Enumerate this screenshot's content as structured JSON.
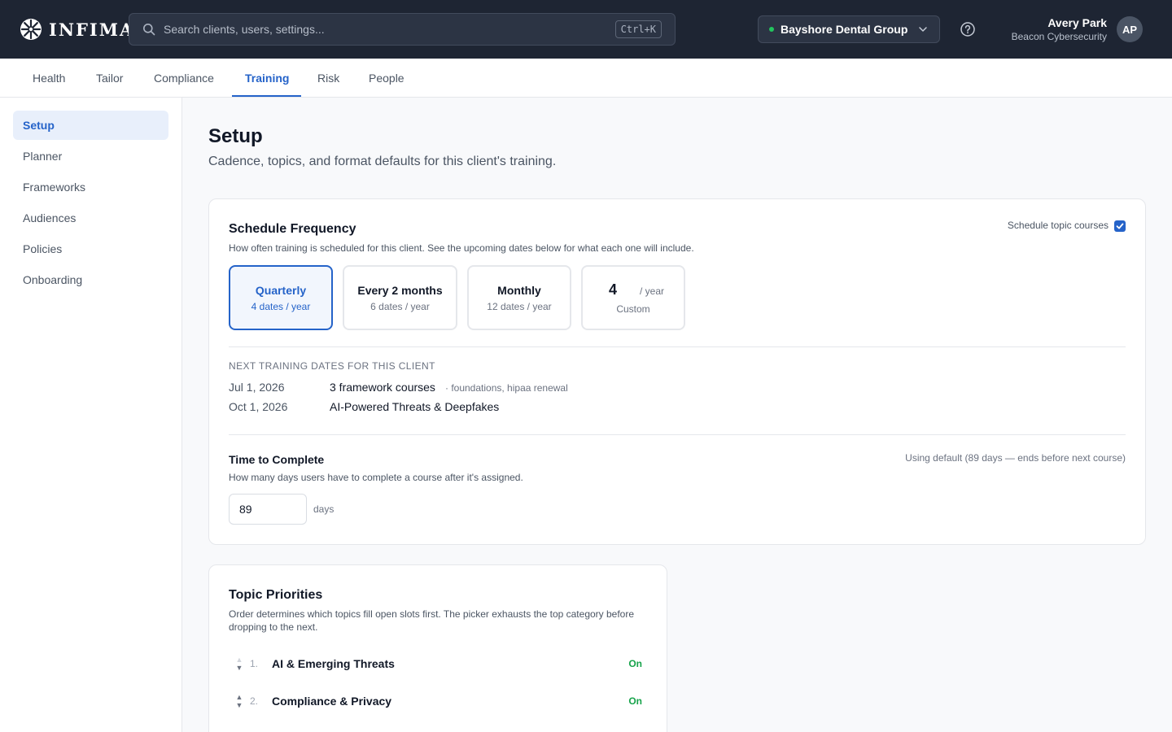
{
  "brand": {
    "name": "INFIMA"
  },
  "search": {
    "placeholder": "Search clients, users, settings...",
    "shortcut": "Ctrl+K"
  },
  "client_selector": {
    "value": "Bayshore Dental Group",
    "status_color": "#22c55e"
  },
  "user": {
    "name": "Avery Park",
    "org": "Beacon Cybersecurity",
    "initials": "AP"
  },
  "tabs": [
    {
      "label": "Health"
    },
    {
      "label": "Tailor"
    },
    {
      "label": "Compliance"
    },
    {
      "label": "Training",
      "active": true
    },
    {
      "label": "Risk"
    },
    {
      "label": "People"
    }
  ],
  "sidebar": {
    "items": [
      {
        "label": "Setup",
        "active": true
      },
      {
        "label": "Planner"
      },
      {
        "label": "Frameworks"
      },
      {
        "label": "Audiences"
      },
      {
        "label": "Policies"
      },
      {
        "label": "Onboarding"
      }
    ]
  },
  "page": {
    "title": "Setup",
    "subtitle": "Cadence, topics, and format defaults for this client's training."
  },
  "schedule": {
    "title": "Schedule Frequency",
    "description": "How often training is scheduled for this client. See the upcoming dates below for what each one will include.",
    "toggle_label": "Schedule topic courses",
    "toggle_checked": true,
    "options": [
      {
        "title": "Quarterly",
        "sub": "4 dates / year",
        "selected": true
      },
      {
        "title": "Every 2 months",
        "sub": "6 dates / year"
      },
      {
        "title": "Monthly",
        "sub": "12 dates / year"
      }
    ],
    "custom": {
      "value": "4",
      "unit": "/ year",
      "label": "Custom"
    },
    "next_dates_heading": "NEXT TRAINING DATES FOR THIS CLIENT",
    "next_dates": [
      {
        "date": "Jul 1, 2026",
        "what": "3 framework courses",
        "note": "· foundations, hipaa renewal"
      },
      {
        "date": "Oct 1, 2026",
        "what": "AI-Powered Threats & Deepfakes",
        "note": ""
      }
    ]
  },
  "time_to_complete": {
    "title": "Time to Complete",
    "description": "How many days users have to complete a course after it's assigned.",
    "default_note": "Using default (89 days — ends before next course)",
    "value": "89",
    "unit": "days"
  },
  "topics": {
    "title": "Topic Priorities",
    "description": "Order determines which topics fill open slots first. The picker exhausts the top category before dropping to the next.",
    "items": [
      {
        "num": "1.",
        "name": "AI & Emerging Threats",
        "status": "On"
      },
      {
        "num": "2.",
        "name": "Compliance & Privacy",
        "status": "On"
      }
    ]
  },
  "colors": {
    "accent": "#2563c9",
    "topbar": "#1e2533",
    "on_status": "#16a34a"
  }
}
